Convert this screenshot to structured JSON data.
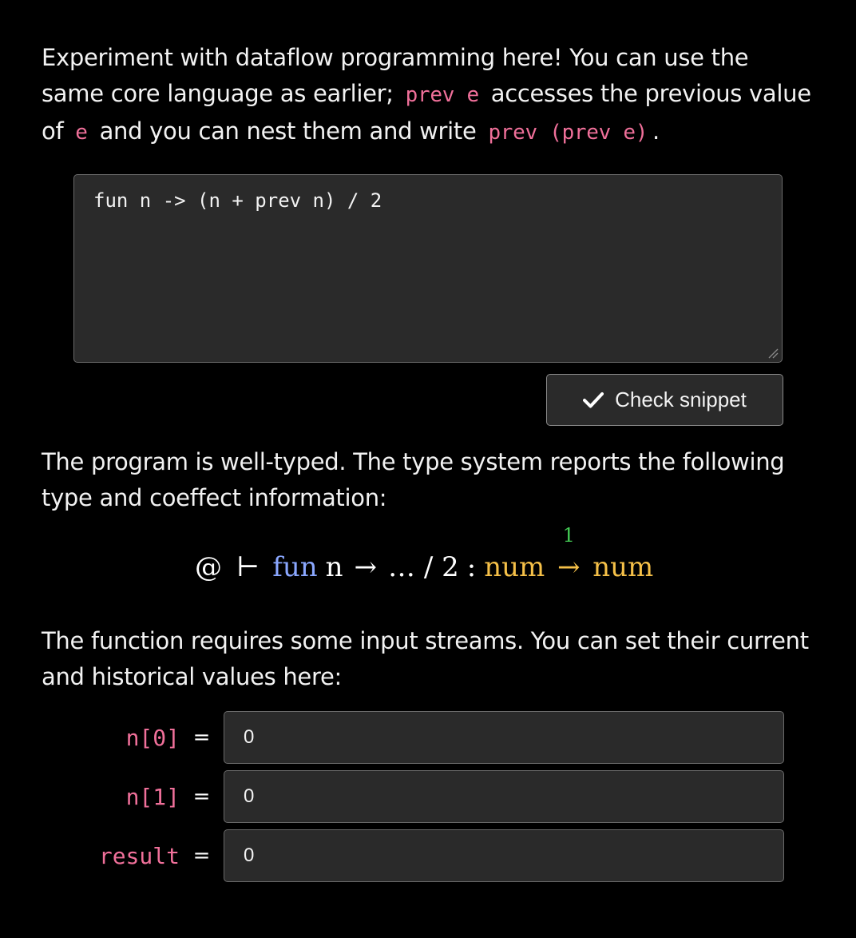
{
  "intro": {
    "text_1": "Experiment with dataflow programming here! You can use the same core language as earlier;",
    "code_1": "prev e",
    "text_2": "accesses the previous value of",
    "code_2": "e",
    "text_3": "and you can nest them and write",
    "code_3": "prev (prev e)",
    "text_4": "."
  },
  "editor": {
    "value": "fun n -> (n + prev n) / 2"
  },
  "check_button": {
    "label": "Check snippet",
    "icon": "checkmark-icon"
  },
  "result_text": "The program is well-typed. The type system reports the following type and coeffect information:",
  "type_info": {
    "context": "@",
    "turnstile": "⊢",
    "fun_keyword": "fun",
    "var": "n",
    "arrow": "→",
    "body": "… / 2",
    "colon": ":",
    "arg_type": "num",
    "coeffect": "1",
    "fn_arrow": "→",
    "ret_type": "num"
  },
  "streams_text": "The function requires some input streams. You can set their current and historical values here:",
  "inputs": [
    {
      "label": "n[0]",
      "eq": "=",
      "value": "0"
    },
    {
      "label": "n[1]",
      "eq": "=",
      "value": "0"
    },
    {
      "label": "result",
      "eq": "=",
      "value": "0"
    }
  ],
  "colors": {
    "background": "#000000",
    "code_pink": "#f0709a",
    "keyword_blue": "#8aa7ff",
    "type_yellow": "#f5c048",
    "coeffect_green": "#44cc55",
    "field_bg": "#2a2a2a"
  }
}
